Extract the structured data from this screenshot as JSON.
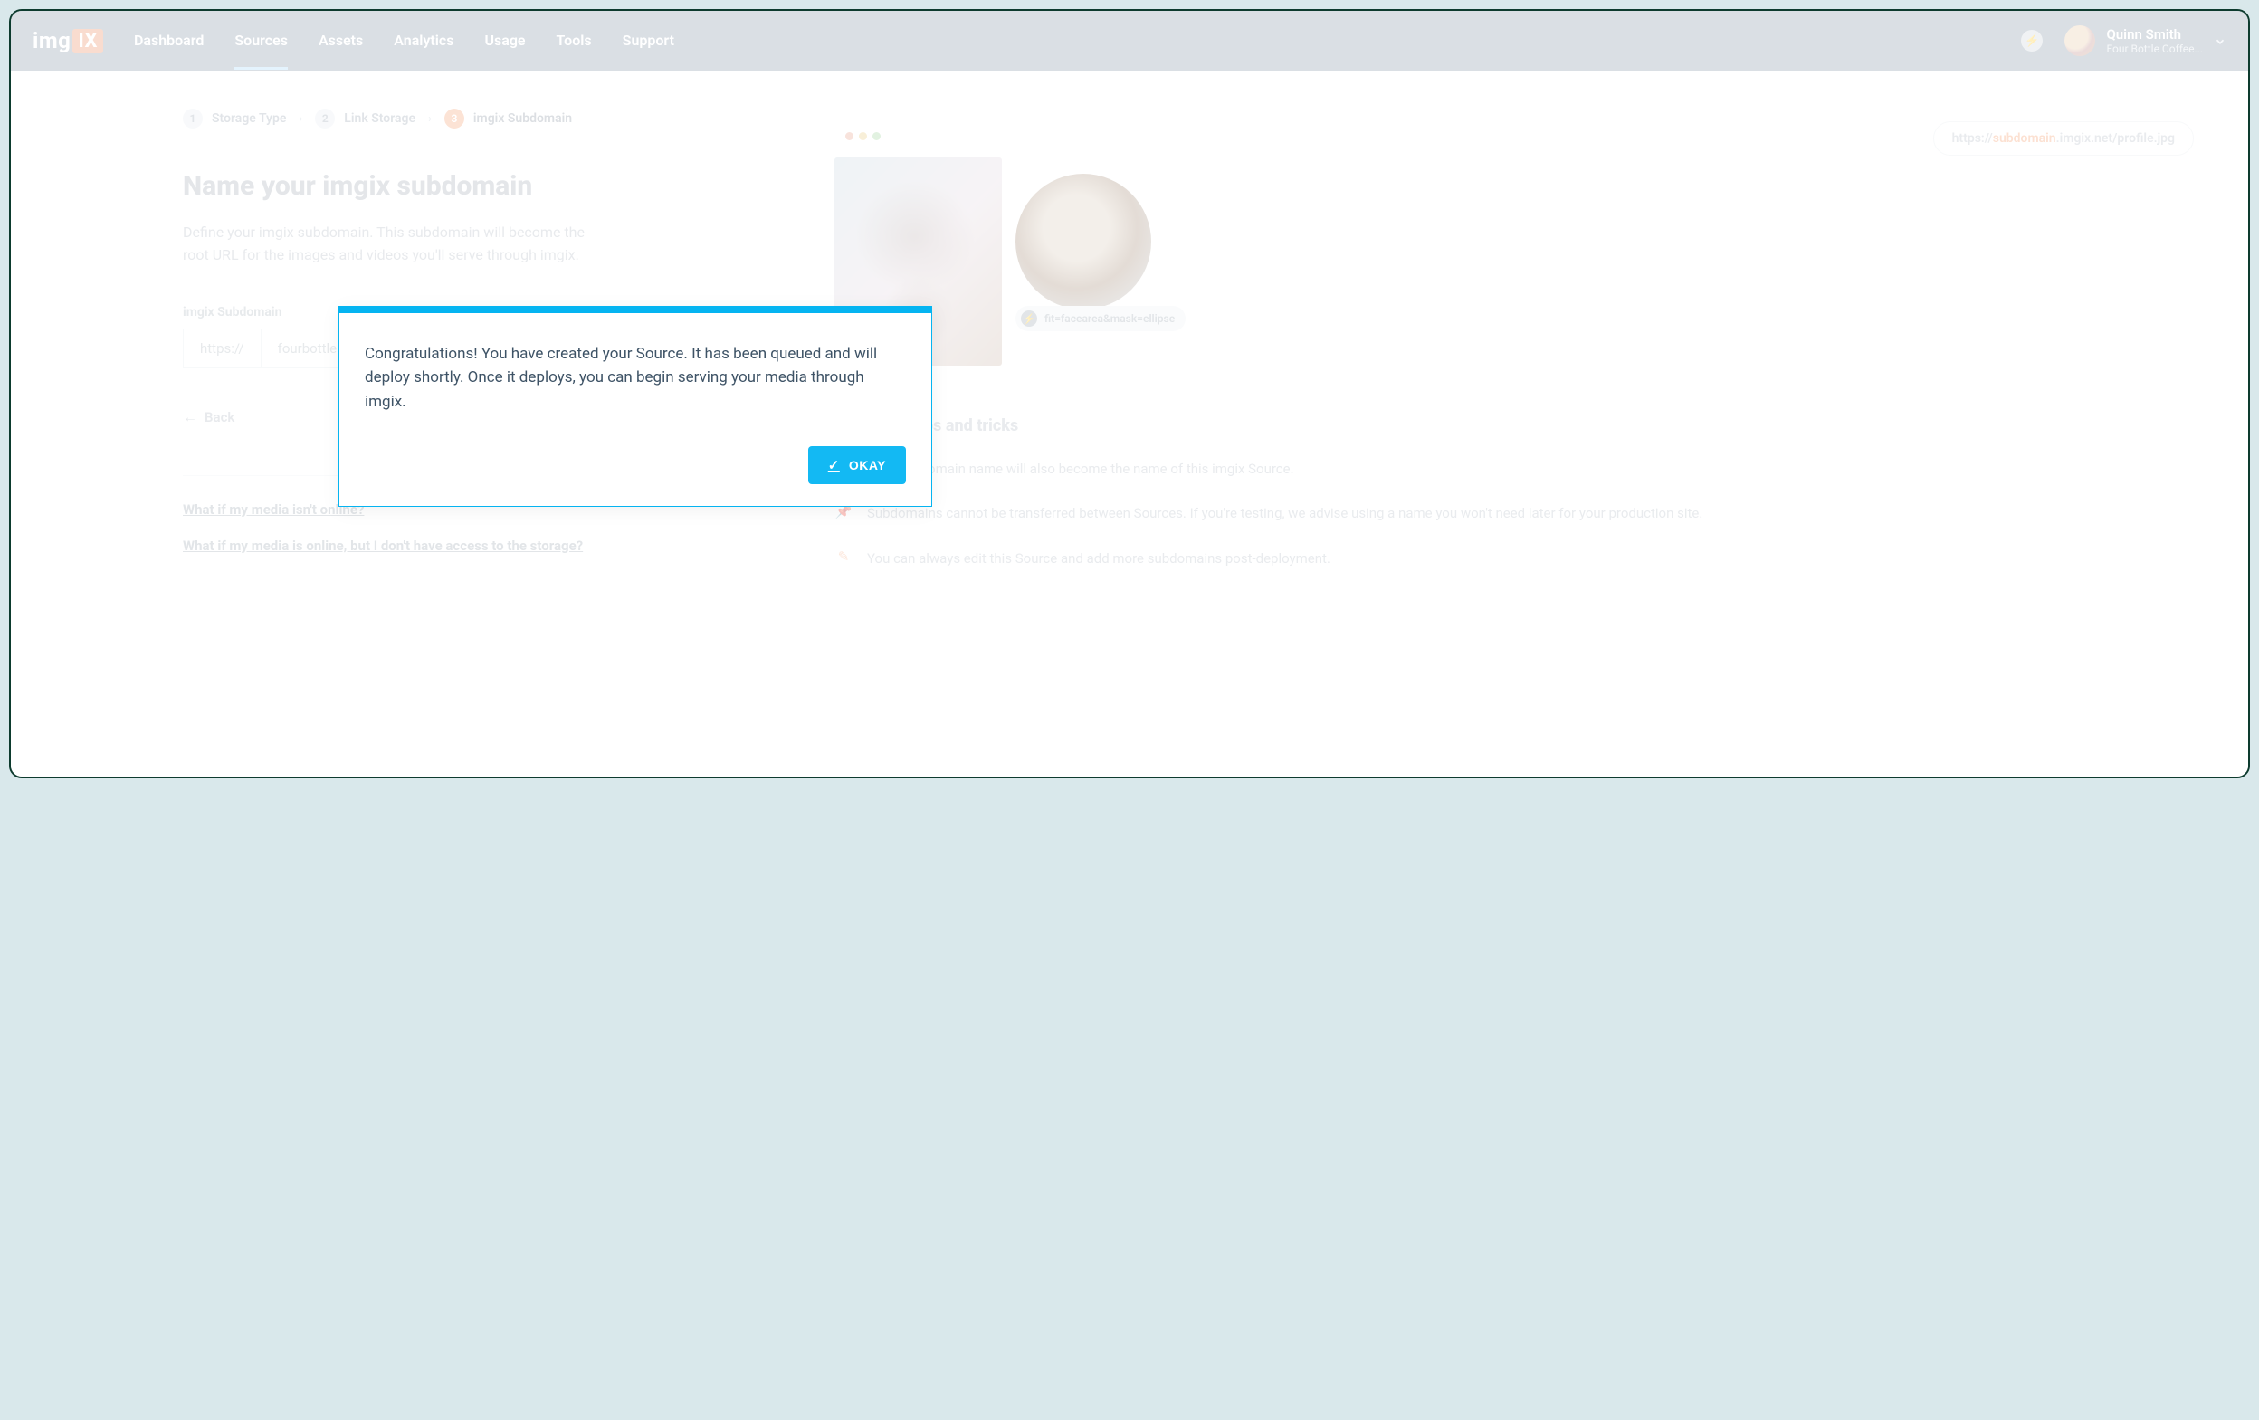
{
  "brand": {
    "prefix": "img",
    "suffix": "IX"
  },
  "nav": {
    "items": [
      "Dashboard",
      "Sources",
      "Assets",
      "Analytics",
      "Usage",
      "Tools",
      "Support"
    ],
    "active_index": 1
  },
  "user": {
    "name": "Quinn Smith",
    "org": "Four Bottle Coffee..."
  },
  "breadcrumbs": {
    "steps": [
      {
        "num": "1",
        "label": "Storage Type"
      },
      {
        "num": "2",
        "label": "Link Storage"
      },
      {
        "num": "3",
        "label": "imgix Subdomain"
      }
    ],
    "current_index": 2
  },
  "page": {
    "title": "Name your imgix subdomain",
    "description": "Define your imgix subdomain. This subdomain will become the root URL for the images and videos you'll serve through imgix.",
    "field_label": "imgix Subdomain",
    "input_prefix": "https://",
    "input_value": "fourbottle",
    "back_label": "Back"
  },
  "faq": [
    "What if my media isn't online?",
    "What if my media is online, but I don't have access to the storage?"
  ],
  "diagram": {
    "url_pre": "https://",
    "url_sub": "subdomain",
    "url_post": ".imgix.net/profile.jpg",
    "param_chip": "fit=facearea&mask=ellipse"
  },
  "tips": {
    "title": "tips and tricks",
    "items": [
      "Your subdomain name will also become the name of this imgix Source.",
      "Subdomains cannot be transferred between Sources. If you're testing, we advise using a name you won't need later for your production site.",
      "You can always edit this Source and add more subdomains post-deployment."
    ]
  },
  "modal": {
    "text": "Congratulations! You have created your Source. It has been queued and will deploy shortly. Once it deploys, you can begin serving your media through imgix.",
    "okay": "OKAY"
  }
}
